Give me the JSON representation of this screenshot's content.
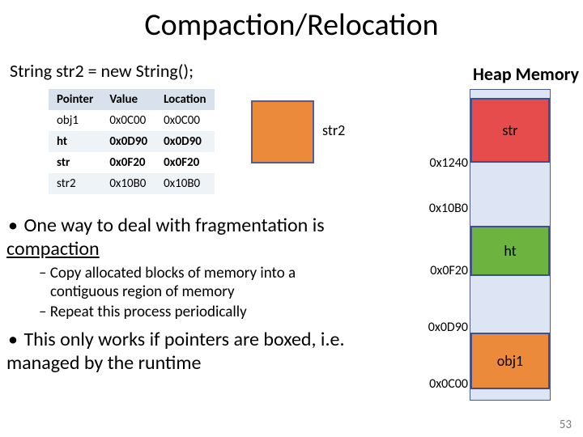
{
  "title": "Compaction/Relocation",
  "code_line": "String str2 = new String();",
  "heap_title": "Heap Memory",
  "pointer_table": {
    "headers": [
      "Pointer",
      "Value",
      "Location"
    ],
    "rows": [
      {
        "pointer": "obj1",
        "value": "0x0C00",
        "location": "0x0C00"
      },
      {
        "pointer": "ht",
        "value": "0x0D90",
        "location": "0x0D90"
      },
      {
        "pointer": "str",
        "value": "0x0F20",
        "location": "0x0F20"
      },
      {
        "pointer": "str2",
        "value": "0x10B0",
        "location": "0x10B0"
      }
    ]
  },
  "str2_label": "str2",
  "bullets": {
    "b1_pre": "One way to deal with fragmentation is ",
    "b1_u": "compaction",
    "sub1": "Copy allocated blocks of memory into a contiguous region of memory",
    "sub2": "Repeat this process periodically",
    "b2": "This only works if pointers are boxed, i.e. managed by the runtime"
  },
  "heap_blocks": {
    "str": {
      "label": "str",
      "color": "#E64C4C"
    },
    "ht": {
      "label": "ht",
      "color": "#6DB33F"
    },
    "obj1": {
      "label": "obj1",
      "color": "#EC8A3C"
    }
  },
  "addresses": {
    "a1240": "0x1240",
    "a10B0": "0x10B0",
    "a0F20": "0x0F20",
    "a0D90": "0x0D90",
    "a0C00": "0x0C00"
  },
  "slide_number": "53"
}
